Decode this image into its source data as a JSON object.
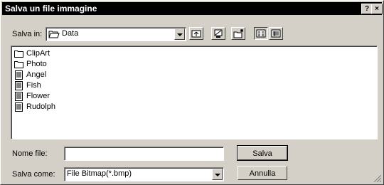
{
  "window": {
    "title": "Salva un file immagine",
    "help_label": "?",
    "close_label": "×"
  },
  "location": {
    "label": "Salva in:",
    "value": "Data"
  },
  "toolbar": {
    "buttons": [
      "up-folder",
      "desktop",
      "new-folder",
      "list-view",
      "details-view"
    ]
  },
  "files": [
    {
      "name": "ClipArt",
      "type": "folder"
    },
    {
      "name": "Photo",
      "type": "folder"
    },
    {
      "name": "Angel",
      "type": "document"
    },
    {
      "name": "Fish",
      "type": "document"
    },
    {
      "name": "Flower",
      "type": "document"
    },
    {
      "name": "Rudolph",
      "type": "document"
    }
  ],
  "filename": {
    "label": "Nome file:",
    "value": ""
  },
  "save_as": {
    "label": "Salva come:",
    "value": "File Bitmap(*.bmp)"
  },
  "buttons": {
    "save": "Salva",
    "cancel": "Annulla"
  }
}
